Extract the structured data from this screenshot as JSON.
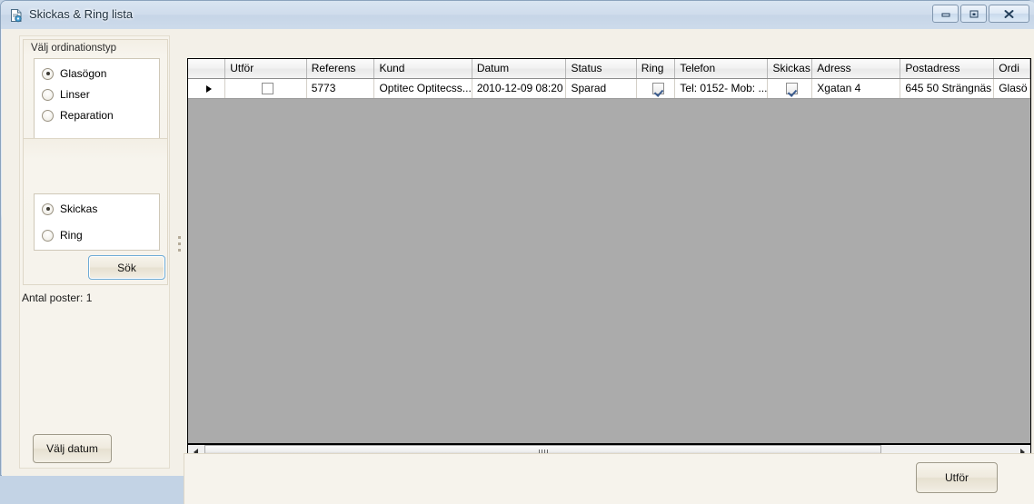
{
  "window": {
    "title": "Skickas & Ring lista",
    "icon": "document-list-icon",
    "minimize_label": "",
    "maximize_label": "",
    "close_label": ""
  },
  "sidebar": {
    "ordination_group": {
      "title": "Välj ordinationstyp",
      "options": [
        {
          "label": "Glasögon",
          "selected": true
        },
        {
          "label": "Linser",
          "selected": false
        },
        {
          "label": "Reparation",
          "selected": false
        }
      ]
    },
    "contact_group": {
      "title": "",
      "options": [
        {
          "label": "Skickas",
          "selected": true
        },
        {
          "label": "Ring",
          "selected": false
        }
      ]
    },
    "search_button": "Sök",
    "record_count": "Antal poster: 1",
    "date_button": "Välj datum"
  },
  "grid": {
    "columns": [
      "Utför",
      "Referens",
      "Kund",
      "Datum",
      "Status",
      "Ring",
      "Telefon",
      "Skickas",
      "Adress",
      "Postadress",
      "Ordi"
    ],
    "rows": [
      {
        "indicator": "current-row-arrow",
        "utfor_checked": false,
        "utfor_selected": true,
        "referens": "5773",
        "kund": "Optitec Optitecss...",
        "datum": "2010-12-09 08:20",
        "status": "Sparad",
        "ring_checked": true,
        "telefon": "Tel: 0152- Mob: ...",
        "skickas_checked": true,
        "adress": "Xgatan 4",
        "postadress": "645 50 Strängnäs",
        "ordinationstyp": "Glasö"
      }
    ]
  },
  "footer": {
    "execute_button": "Utför"
  },
  "colors": {
    "selection_blue": "#3399ff",
    "grid_empty_gray": "#ababab",
    "panel_beige": "#f6f3ec",
    "titlebar_blue": "#cfdcec"
  }
}
